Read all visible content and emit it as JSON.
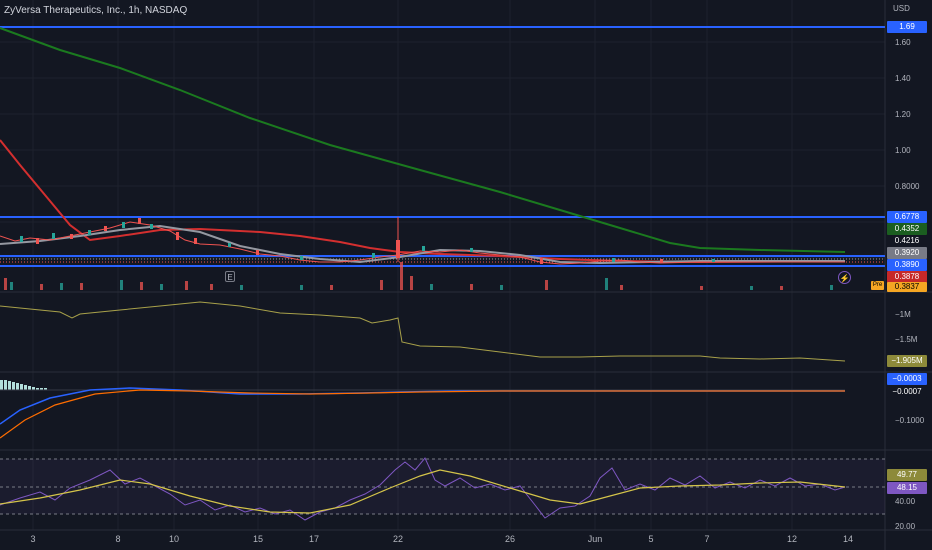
{
  "header": {
    "title": "ZyVersa Therapeutics, Inc., 1h, NASDAQ",
    "currency": "USD"
  },
  "price_axis": [
    "1.60",
    "1.40",
    "1.20",
    "1.00",
    "0.8000"
  ],
  "price_tags": [
    {
      "value": "1.69",
      "bg": "#2962ff",
      "fg": "#ffffff"
    },
    {
      "value": "0.6778",
      "bg": "#2962ff",
      "fg": "#ffffff"
    },
    {
      "value": "0.4352",
      "bg": "#1b5e20",
      "fg": "#ffffff"
    },
    {
      "value": "0.4216",
      "bg": "#131722",
      "fg": "#ffffff"
    },
    {
      "value": "0.3920",
      "bg": "#787b86",
      "fg": "#ffffff"
    },
    {
      "value": "0.3890",
      "bg": "#2962ff",
      "fg": "#ffffff"
    },
    {
      "value": "0.3878",
      "bg": "#c62828",
      "fg": "#ffffff"
    },
    {
      "value": "0.3837",
      "bg": "#f5a623",
      "fg": "#000000"
    }
  ],
  "obv_axis": [
    "−1M",
    "−1.5M"
  ],
  "obv_tag": {
    "value": "−1.905M",
    "bg": "#8d8a3a",
    "fg": "#ffffff"
  },
  "macd_axis": [
    "−0.1000"
  ],
  "macd_tags": [
    {
      "value": "−0.0003",
      "bg": "#2962ff",
      "fg": "#ffffff"
    },
    {
      "value": "−0.0007",
      "bg": "#131722",
      "fg": "#ffffff"
    }
  ],
  "rsi_axis": [
    "40.00",
    "20.00"
  ],
  "rsi_tags": [
    {
      "value": "49.77",
      "bg": "#8d8a3a",
      "fg": "#ffffff"
    },
    {
      "value": "48.15",
      "bg": "#7e57c2",
      "fg": "#ffffff"
    }
  ],
  "time_axis": [
    "3",
    "8",
    "10",
    "15",
    "17",
    "22",
    "26",
    "Jun",
    "5",
    "7",
    "12",
    "14"
  ],
  "markers": {
    "earnings": "E",
    "flash": "⚡",
    "pre": "Pre"
  },
  "colors": {
    "background": "#131722",
    "up": "#26a69a",
    "down": "#ef5350",
    "ma_long": "#1b7a1f",
    "ma_mid": "#d32f2f",
    "ma_short": "#9598a1",
    "levels": "#2962ff",
    "obv": "#a8a14a",
    "rsi": "#7e57c2",
    "rsi_ma": "#d4c44a"
  }
}
